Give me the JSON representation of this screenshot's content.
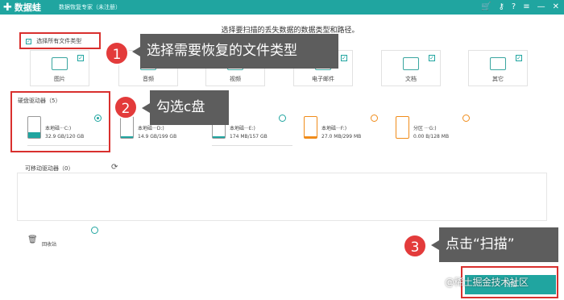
{
  "app": {
    "name": "数据蛙",
    "subtitle": "数据恢复专家（未注册）"
  },
  "toolbar_icons": [
    "cart-icon",
    "key-icon",
    "help-icon",
    "menu-icon",
    "minimize-icon",
    "close-icon"
  ],
  "prompt": "选择要扫描的丢失数据的数据类型和路径。",
  "select_all": {
    "label": "选择所有文件类型",
    "checked": true
  },
  "file_types": [
    {
      "label": "图片",
      "icon": "image-icon",
      "checked": true
    },
    {
      "label": "音频",
      "icon": "audio-icon",
      "checked": true
    },
    {
      "label": "视频",
      "icon": "video-icon",
      "checked": true
    },
    {
      "label": "电子邮件",
      "icon": "email-icon",
      "checked": true
    },
    {
      "label": "文档",
      "icon": "document-icon",
      "checked": true
    },
    {
      "label": "其它",
      "icon": "other-icon",
      "checked": true
    }
  ],
  "annotations": [
    {
      "number": "1",
      "text": "选择需要恢复的文件类型"
    },
    {
      "number": "2",
      "text": "勾选c盘"
    },
    {
      "number": "3",
      "text": "点击“扫描”"
    }
  ],
  "hard_drives": {
    "title": "硬盘驱动器（5）",
    "drives": [
      {
        "name": "本地磁···C:)",
        "size": "32.9 GB/120 GB",
        "selected": true,
        "usage": 0.27,
        "color": "#20a5a0"
      },
      {
        "name": "本地磁···D:)",
        "size": "14.9 GB/199 GB",
        "selected": false,
        "usage": 0.07,
        "color": "#20a5a0"
      },
      {
        "name": "本地磁···E:)",
        "size": "174 MB/157 GB",
        "selected": false,
        "usage": 0.01,
        "color": "#20a5a0"
      },
      {
        "name": "本地磁···F:)",
        "size": "27.0 MB/299 MB",
        "selected": false,
        "usage": 0.09,
        "color": "#f08c1a"
      },
      {
        "name": "分区 ···G:)",
        "size": "0.00  B/128 MB",
        "selected": false,
        "usage": 0.0,
        "color": "#f08c1a"
      }
    ]
  },
  "removable": {
    "title": "可移动驱动器（0）"
  },
  "recycle_bin": {
    "label": "回收站"
  },
  "scan_button": {
    "label": "扫描"
  },
  "watermark": "@稀土掘金技术社区"
}
